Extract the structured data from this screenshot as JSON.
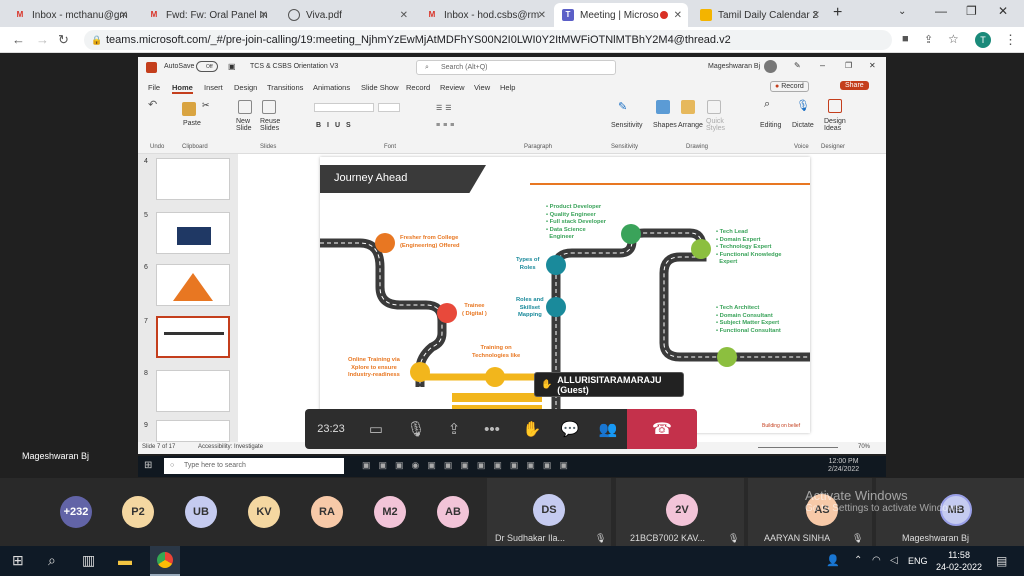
{
  "browser": {
    "tabs": [
      {
        "label": "Inbox - mcthanu@gm",
        "icon": "gmail-icon"
      },
      {
        "label": "Fwd: Fw: Oral Panel In",
        "icon": "gmail-icon"
      },
      {
        "label": "Viva.pdf",
        "icon": "globe-icon"
      },
      {
        "label": "Inbox - hod.csbs@rm",
        "icon": "gmail-icon"
      },
      {
        "label": "Meeting | Microso",
        "icon": "teams-icon"
      },
      {
        "label": "Tamil Daily Calendar 2",
        "icon": "web-icon"
      }
    ],
    "url": "teams.microsoft.com/_#/pre-join-calling/19:meeting_NjhmYzEwMjAtMDFhYS00N2I0LWI0Y2ItMWFiOTNlMTBhY2M4@thread.v2",
    "profile_initial": "T"
  },
  "teams": {
    "presenter_name": "Mageshwaran Bj",
    "call_time": "23:23",
    "raised_hand_name": "ALLURISITARAMARAJU (Guest)"
  },
  "ppt": {
    "autosave": "AutoSave",
    "autosave_state": "Off",
    "filename": "TCS & CSBS Orientation V3",
    "search_placeholder": "Search (Alt+Q)",
    "user": "Mageshwaran Bj",
    "tabs": [
      "File",
      "Home",
      "Insert",
      "Design",
      "Transitions",
      "Animations",
      "Slide Show",
      "Record",
      "Review",
      "View",
      "Help"
    ],
    "record_label": "Record",
    "share_label": "Share",
    "groups": [
      "Undo",
      "Clipboard",
      "Slides",
      "Font",
      "Paragraph",
      "Drawing",
      "Voice",
      "Designer"
    ],
    "ribbon_labels": {
      "paste": "Paste",
      "new_slide": "New\nSlide",
      "reuse_slides": "Reuse\nSlides",
      "sensitivity": "Sensitivity",
      "shapes": "Shapes",
      "arrange": "Arrange",
      "quick_styles": "Quick\nStyles",
      "editing": "Editing",
      "dictate": "Dictate",
      "design_ideas": "Design\nIdeas"
    },
    "thumb_numbers": [
      "4",
      "5",
      "6",
      "7",
      "8",
      "9"
    ],
    "status_slide": "Slide 7 of 17",
    "status_accessibility": "Accessibility: Investigate",
    "status_notes": "Notes",
    "status_zoom": "70%",
    "slide": {
      "title": "Journey Ahead",
      "labels": {
        "fresher": "Fresher from College\n(Engineering) Offered",
        "trainee": "Trainee\n( Digital )",
        "online": "Online Training via\nXplore to ensure\nIndustry-readiness",
        "training": "Training on\nTechnologies like",
        "types": "Types of\nRoles",
        "roles": "Roles and\nSkillset\nMapping",
        "dev": "• Product Developer\n• Quality Engineer\n• Full stack Developer\n• Data Science\n  Engineer",
        "lead": "• Tech Lead\n• Domain Expert\n• Technology Expert\n• Functional Knowledge\n  Expert",
        "arch": "• Tech Architect\n• Domain Consultant\n• Subject Matter Expert\n• Functional Consultant",
        "footer": "Building on belief"
      }
    }
  },
  "win_inner": {
    "search": "Type here to search",
    "time": "12:00 PM",
    "date": "2/24/2022"
  },
  "gallery": {
    "avatars": [
      {
        "t": "+232",
        "c": "#6264a7"
      },
      {
        "t": "P2",
        "c": "#f4d7a1"
      },
      {
        "t": "UB",
        "c": "#c5cbf0"
      },
      {
        "t": "KV",
        "c": "#f4d7a1"
      },
      {
        "t": "RA",
        "c": "#f7c9a8"
      },
      {
        "t": "M2",
        "c": "#f2c4d8"
      },
      {
        "t": "AB",
        "c": "#f2c4d8"
      }
    ],
    "tiles": [
      {
        "initials": "DS",
        "name": "Dr Sudhakar Ila...",
        "color": "#c5cbf0"
      },
      {
        "initials": "2V",
        "name": "21BCB7002 KAV...",
        "color": "#f2c4d8"
      },
      {
        "initials": "AS",
        "name": "AARYAN SINHA",
        "color": "#f7c9a8"
      },
      {
        "initials": "MB",
        "name": "Mageshwaran Bj",
        "color": "#c5cbf0"
      }
    ],
    "activate_title": "Activate Windows",
    "activate_sub": "Go to Settings to activate Windows."
  },
  "taskbar": {
    "time": "11:58",
    "date": "24-02-2022",
    "lang": "ENG"
  }
}
